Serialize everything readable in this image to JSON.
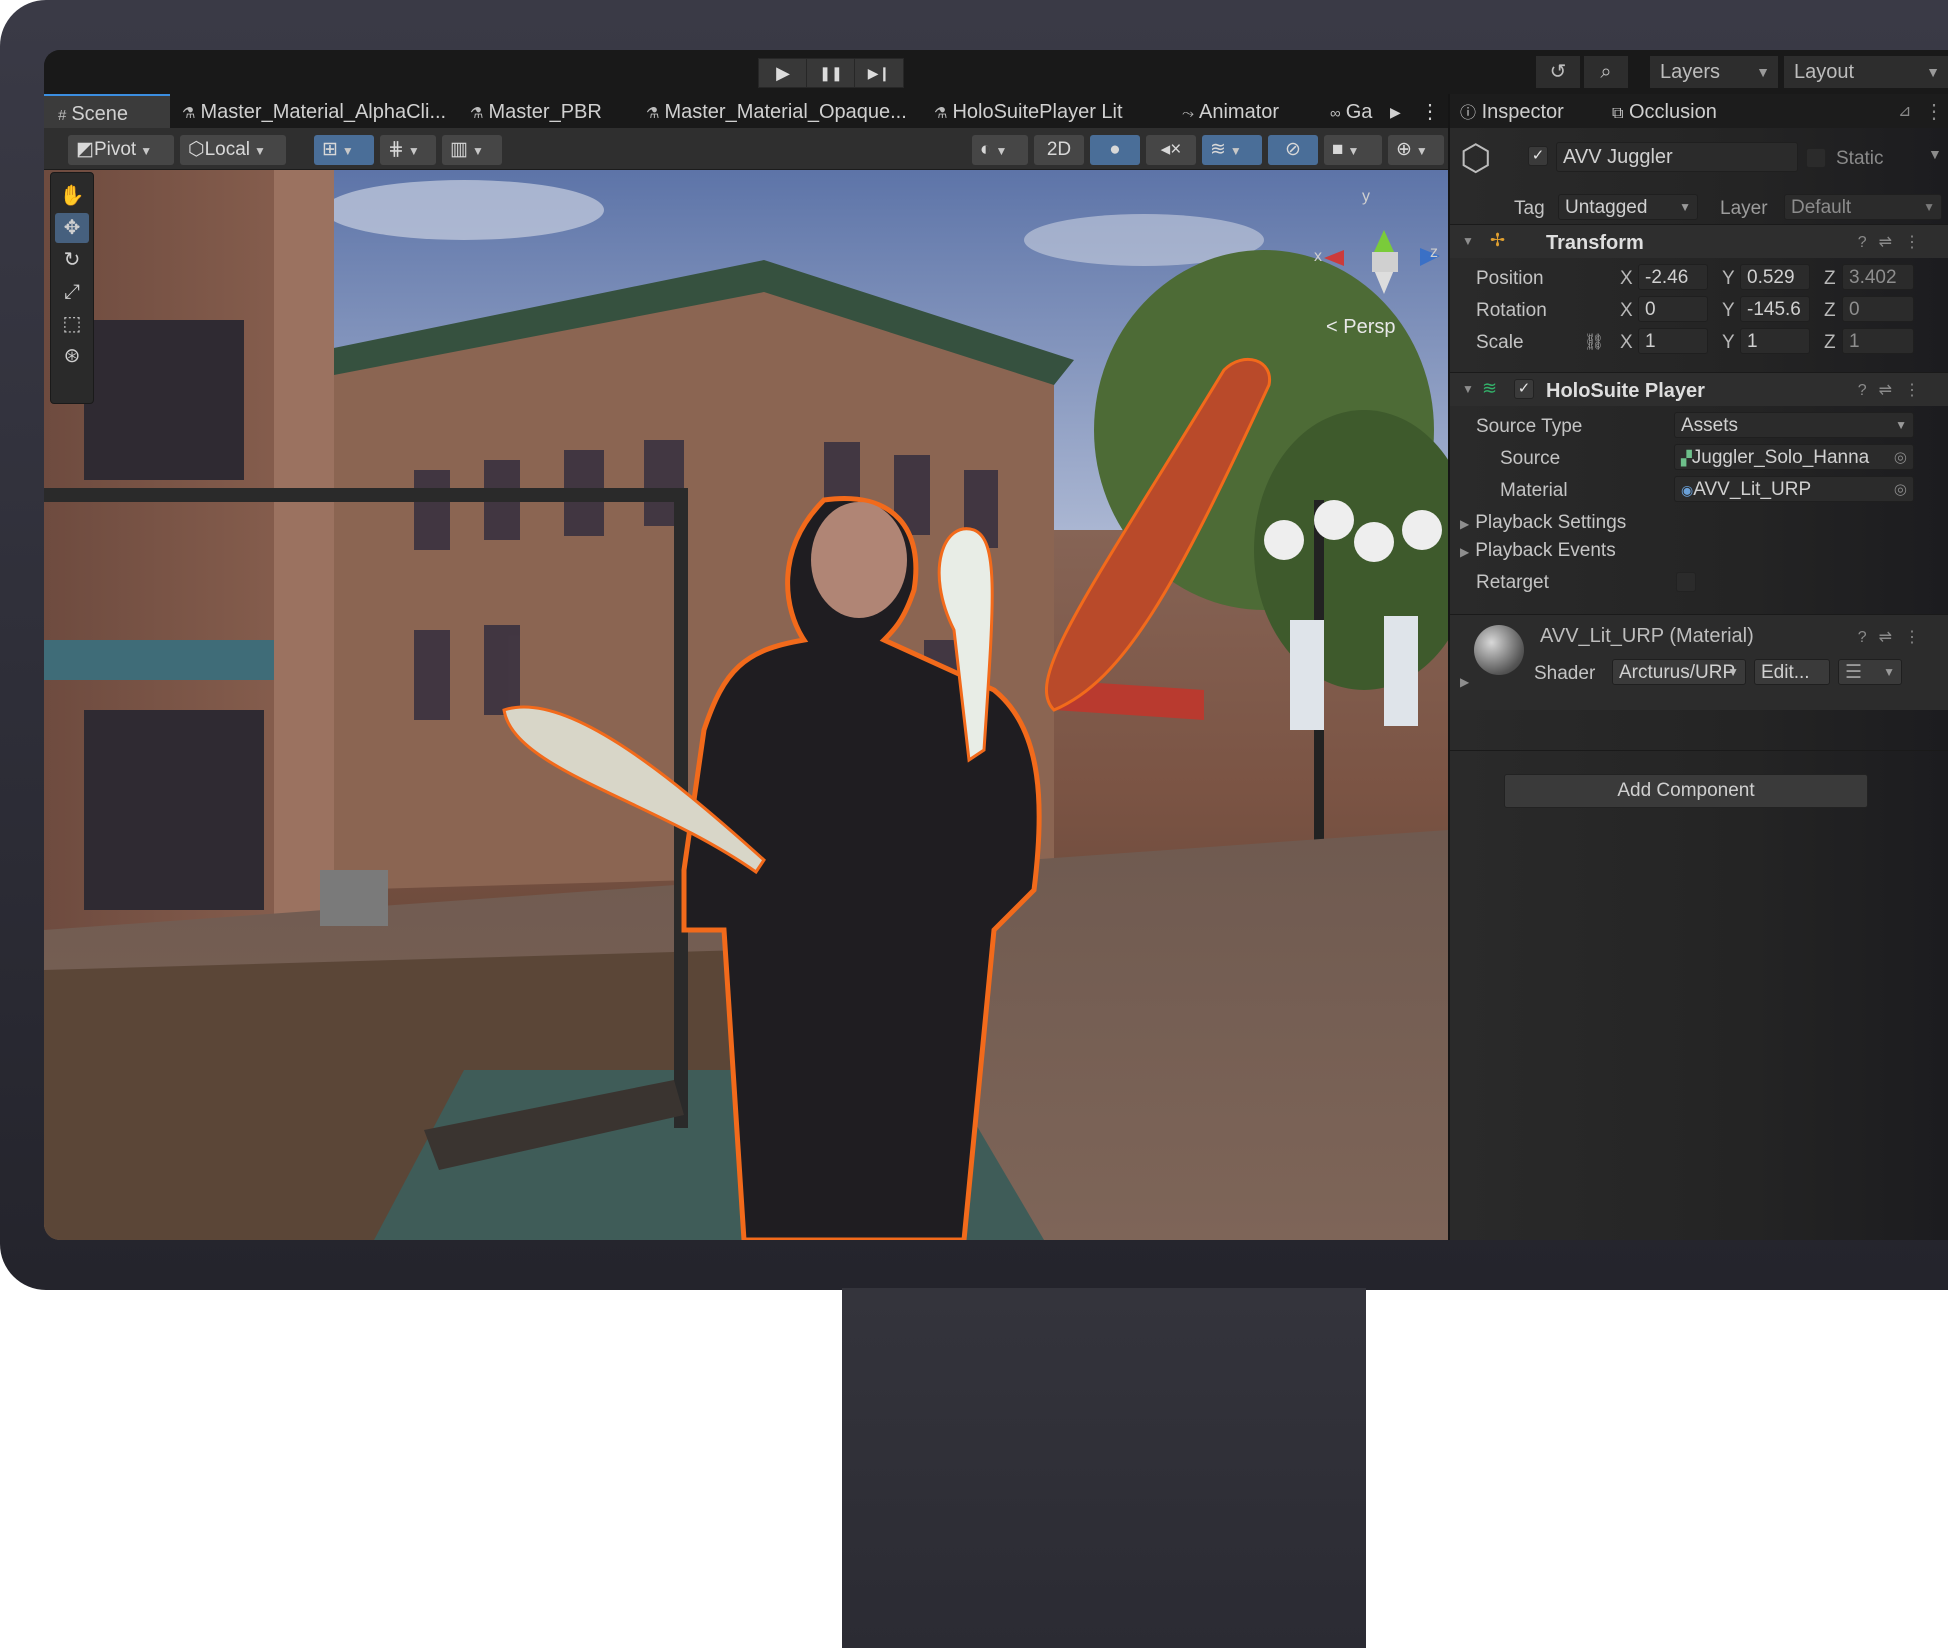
{
  "toolbar": {
    "play": "▶",
    "pause": "❚❚",
    "step": "▶❙",
    "history_icon": "history-icon",
    "search_icon": "search-icon",
    "layers": "Layers",
    "layout": "Layout"
  },
  "scene_tabs": [
    {
      "label": "Scene",
      "icon": "#"
    },
    {
      "label": "Master_Material_AlphaCli...",
      "icon": "⚗"
    },
    {
      "label": "Master_PBR",
      "icon": "⚗"
    },
    {
      "label": "Master_Material_Opaque...",
      "icon": "⚗"
    },
    {
      "label": "HoloSuitePlayer Lit",
      "icon": "⚗"
    },
    {
      "label": "Animator",
      "icon": "⤳"
    },
    {
      "label": "Ga",
      "icon": "∞"
    }
  ],
  "scene_toolbar": {
    "pivot": "Pivot",
    "local": "Local",
    "twod": "2D"
  },
  "scene": {
    "persp": "< Persp",
    "gizmo_y": "y",
    "gizmo_x": "x",
    "gizmo_z": "z"
  },
  "inspector": {
    "tab_inspector": "Inspector",
    "tab_occlusion": "Occlusion",
    "object_name": "AVV Juggler",
    "static_label": "Static",
    "tag_label": "Tag",
    "tag_value": "Untagged",
    "layer_label": "Layer",
    "layer_value": "Default",
    "transform": {
      "title": "Transform",
      "position_label": "Position",
      "rotation_label": "Rotation",
      "scale_label": "Scale",
      "axis_x": "X",
      "axis_y": "Y",
      "axis_z": "Z",
      "position": {
        "x": "-2.46",
        "y": "0.529",
        "z": "3.402"
      },
      "rotation": {
        "x": "0",
        "y": "-145.6",
        "z": "0"
      },
      "scale": {
        "x": "1",
        "y": "1",
        "z": "1"
      }
    },
    "holosuite": {
      "title": "HoloSuite Player",
      "source_type_label": "Source Type",
      "source_type_value": "Assets",
      "source_label": "Source",
      "source_value": "Juggler_Solo_Hanna",
      "material_label": "Material",
      "material_value": "AVV_Lit_URP",
      "playback_settings": "Playback Settings",
      "playback_events": "Playback Events",
      "retarget": "Retarget"
    },
    "material": {
      "name": "AVV_Lit_URP (Material)",
      "shader_label": "Shader",
      "shader_value": "Arcturus/URP",
      "edit_label": "Edit..."
    },
    "add_component": "Add Component"
  }
}
